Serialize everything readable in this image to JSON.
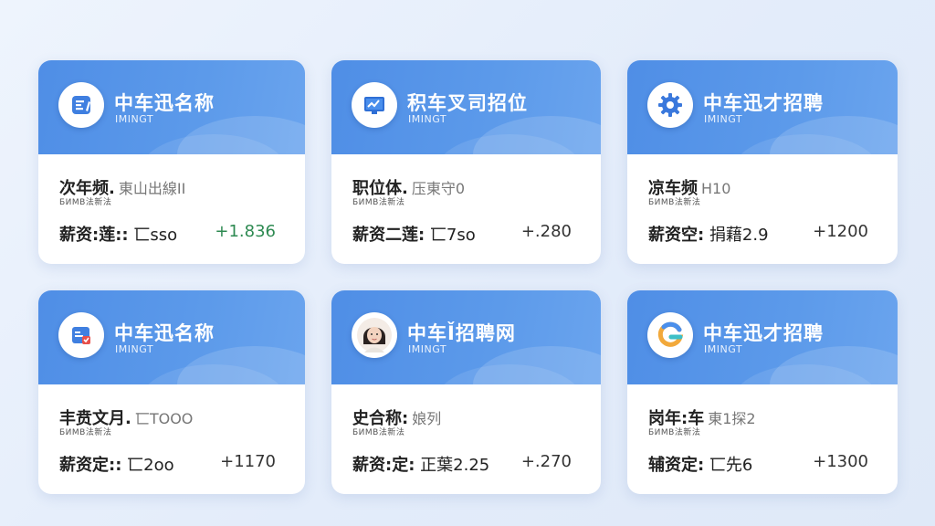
{
  "cards": [
    {
      "title": "中车迅名称",
      "subtitle": "IMINGT",
      "info_main": "次年频.",
      "info_extra": "東山出線ΙΙ",
      "info_small": "БИМВ法新法",
      "salary_label": "薪资:莲::",
      "salary_value": "匸sso",
      "delta": "+1.836",
      "delta_color": "#2e8a52",
      "icon": "document-pen-icon"
    },
    {
      "title": "积车叉司招位",
      "subtitle": "IMINGT",
      "info_main": "职位体.",
      "info_extra": "压東守0",
      "info_small": "БИМВ法新法",
      "salary_label": "薪资二莲:",
      "salary_value": "匸7so",
      "delta": "+.280",
      "delta_color": "#333333",
      "icon": "monitor-chart-icon"
    },
    {
      "title": "中车迅才招聘",
      "subtitle": "IMINGT",
      "info_main": "凉车频",
      "info_extra": "H10",
      "info_small": "БИМВ法新法",
      "salary_label": "薪资空:",
      "salary_value": "捐藉2.9",
      "delta": "+1200",
      "delta_color": "#333333",
      "icon": "gear-icon"
    },
    {
      "title": "中车迅名称",
      "subtitle": "IMINGT",
      "info_main": "丰贲文月.",
      "info_extra": "匸ΤΟΟΟ",
      "info_small": "БИМВ法新法",
      "salary_label": "薪资定::",
      "salary_value": "匸2oo",
      "delta": "+1170",
      "delta_color": "#333333",
      "icon": "calendar-badge-icon"
    },
    {
      "title": "中车Ǐ招聘网",
      "subtitle": "IMINGT",
      "info_main": "史合称:",
      "info_extra": "娘列",
      "info_small": "БИМВ法新法",
      "salary_label": "薪资:定:",
      "salary_value": "正葉2.25",
      "delta": "+.270",
      "delta_color": "#333333",
      "icon": "person-avatar-icon"
    },
    {
      "title": "中车迅才招聘",
      "subtitle": "IMINGT",
      "info_main": "岗年:车",
      "info_extra": "東1探2",
      "info_small": "БИМВ法新法",
      "salary_label": "辅资定:",
      "salary_value": "匸先6",
      "delta": "+1300",
      "delta_color": "#333333",
      "icon": "colorful-g-logo-icon"
    }
  ]
}
